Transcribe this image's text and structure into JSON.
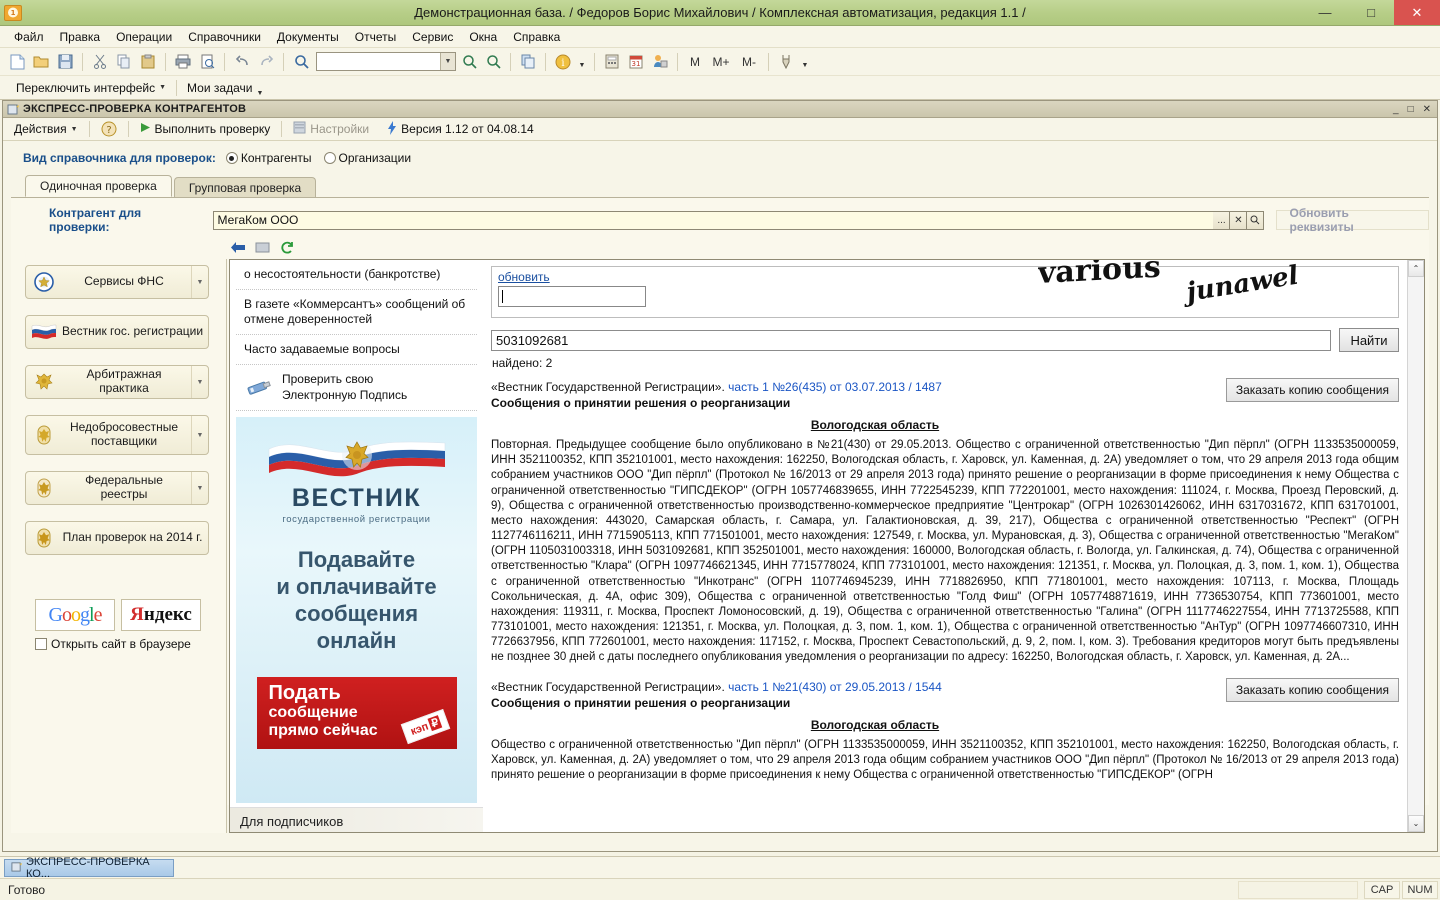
{
  "window": {
    "title": "Демонстрационная база. / Федоров Борис Михайлович /  Комплексная автоматизация, редакция 1.1 /",
    "app_icon": "1C",
    "minimize": "—",
    "maximize": "□",
    "close": "✕"
  },
  "menu": {
    "items": [
      {
        "label": "Файл"
      },
      {
        "label": "Правка"
      },
      {
        "label": "Операции"
      },
      {
        "label": "Справочники"
      },
      {
        "label": "Документы"
      },
      {
        "label": "Отчеты"
      },
      {
        "label": "Сервис"
      },
      {
        "label": "Окна"
      },
      {
        "label": "Справка"
      }
    ]
  },
  "toolbar": {
    "combo_value": "",
    "memory": [
      "M",
      "M+",
      "M-"
    ]
  },
  "toolbar2": {
    "switch_interface": "Переключить интерфейс",
    "my_tasks": "Мои задачи"
  },
  "mdi": {
    "title": "ЭКСПРЕСС-ПРОВЕРКА КОНТРАГЕНТОВ",
    "minimize": "_",
    "maximize": "□",
    "close": "✕",
    "toolbar": {
      "actions": "Действия",
      "help": "?",
      "run_check": "Выполнить проверку",
      "settings": "Настройки",
      "version": "Версия 1.12 от 04.08.14"
    }
  },
  "form": {
    "kind_label": "Вид справочника для проверок:",
    "radio_options": [
      {
        "label": "Контрагенты",
        "selected": true
      },
      {
        "label": "Организации",
        "selected": false
      }
    ],
    "tabs": [
      {
        "label": "Одиночная проверка",
        "active": true
      },
      {
        "label": "Групповая проверка",
        "active": false
      }
    ],
    "contractor_label": "Контрагент для проверки:",
    "contractor_value": "МегаКом ООО",
    "field_buttons": [
      "...",
      "✕",
      "⌕"
    ],
    "refresh_button": "Обновить реквизиты"
  },
  "sidebar": {
    "buttons": [
      {
        "label": "Сервисы ФНС",
        "has_dropdown": true
      },
      {
        "label": "Вестник гос. регистрации",
        "has_dropdown": false
      },
      {
        "label": "Арбитражная практика",
        "has_dropdown": true
      },
      {
        "label": "Недобросовестные поставщики",
        "has_dropdown": true
      },
      {
        "label": "Федеральные реестры",
        "has_dropdown": true
      },
      {
        "label": "План проверок на 2014 г.",
        "has_dropdown": false
      }
    ],
    "search_engines": [
      {
        "name": "Google"
      },
      {
        "name": "Яндекс"
      }
    ],
    "open_in_browser": "Открыть сайт в браузере",
    "open_in_browser_checked": false
  },
  "browser": {
    "menu_items": [
      "о несостоятельности (банкротстве)",
      "В газете «Коммерсантъ» сообщений об отмене доверенностей",
      "Часто задаваемые вопросы"
    ],
    "eds_item": "Проверить свою\nЭлектронную Подпись",
    "eds_line1": "Проверить свою",
    "eds_line2": "Электронную Подпись",
    "banner": {
      "title": "ВЕСТНИК",
      "subtitle": "государственной регистрации",
      "headline_l1": "Подавайте",
      "headline_l2": "и оплачивайте",
      "headline_l3": "сообщения",
      "headline_l4": "онлайн",
      "cta_l1": "Подать",
      "cta_l2": "сообщение",
      "cta_l3": "прямо сейчас",
      "badge": "кэп"
    },
    "subscribers": "Для подписчиков",
    "captcha": {
      "refresh_link": "обновить",
      "input_value": "",
      "image_text_1": "various",
      "image_text_2": "junawel"
    },
    "search": {
      "value": "5031092681",
      "button": "Найти",
      "found": "найдено: 2"
    },
    "results": [
      {
        "source": "«Вестник Государственной Регистрации».",
        "link": "часть 1 №26(435) от 03.07.2013 / 1487",
        "subtitle": "Сообщения о принятии решения о реорганизации",
        "region": "Вологодская область",
        "order_button": "Заказать копию сообщения",
        "body": "Повторная. Предыдущее сообщение было опубликовано в №21(430) от 29.05.2013. Общество с ограниченной ответственностью \"Дип пёрпл\" (ОГРН 1133535000059, ИНН 3521100352, КПП 352101001, место нахождения: 162250, Вологодская область, г. Харовск, ул. Каменная, д. 2А) уведомляет о том, что 29 апреля 2013 года общим собранием участников ООО \"Дип пёрпл\" (Протокол № 16/2013 от 29 апреля 2013 года) принято решение о реорганизации в форме присоединения к нему Общества с ограниченной ответственностью \"ГИПСДЕКОР\" (ОГРН 1057746839655, ИНН 7722545239, КПП 772201001, место нахождения: 111024, г. Москва, Проезд Перовский, д. 9), Общества с ограниченной ответственностью производственно-коммерческое предприятие \"Центрокар\" (ОГРН 1026301426062, ИНН 6317031672, КПП 631701001, место нахождения: 443020, Самарская область, г. Самара, ул. Галактионовская, д. 39, 217), Общества с ограниченной ответственностью \"Респект\" (ОГРН 1127746116211, ИНН 7715905113, КПП 771501001, место нахождения: 127549, г. Москва, ул. Мурановская, д. 3), Общества с ограниченной ответственностью \"МегаКом\" (ОГРН 1105031003318, ИНН 5031092681, КПП 352501001, место нахождения: 160000, Вологодская область, г. Вологда, ул. Галкинская, д. 74), Общества с ограниченной ответственностью \"Клара\" (ОГРН 1097746621345, ИНН 7715778024, КПП 773101001, место нахождения: 121351, г. Москва, ул. Полоцкая, д. 3, пом. 1, ком. 1), Общества с ограниченной ответственностью \"Инкотранс\" (ОГРН 1107746945239, ИНН 7718826950, КПП 771801001, место нахождения: 107113, г. Москва, Площадь Сокольническая, д. 4А, офис 309), Общества с ограниченной ответственностью \"Голд Фиш\" (ОГРН 1057748871619, ИНН 7736530754, КПП 773601001, место нахождения: 119311, г. Москва, Проспект Ломоносовский, д. 19), Общества с ограниченной ответственностью \"Галина\" (ОГРН 1117746227554, ИНН 7713725588, КПП 773101001, место нахождения: 121351, г. Москва, ул. Полоцкая, д. 3, пом. 1, ком. 1), Общества с ограниченной ответственностью \"АнТур\" (ОГРН 1097746607310, ИНН 7726637956, КПП 772601001, место нахождения: 117152, г. Москва, Проспект Севастопольский, д. 9, 2, пом. I, ком. 3). Требования кредиторов могут быть предъявлены не позднее 30 дней с даты последнего опубликования уведомления о реорганизации по адресу: 162250, Вологодская область, г. Харовск, ул. Каменная, д. 2А..."
      },
      {
        "source": "«Вестник Государственной Регистрации».",
        "link": "часть 1 №21(430) от 29.05.2013 / 1544",
        "subtitle": "Сообщения о принятии решения о реорганизации",
        "region": "Вологодская область",
        "order_button": "Заказать копию сообщения",
        "body": "Общество с ограниченной ответственностью \"Дип пёрпл\" (ОГРН 1133535000059, ИНН 3521100352, КПП 352101001, место нахождения: 162250, Вологодская область, г. Харовск, ул. Каменная, д. 2А) уведомляет о том, что 29 апреля 2013 года общим собранием участников ООО \"Дип пёрпл\" (Протокол № 16/2013 от 29 апреля 2013 года) принято решение о реорганизации в форме присоединения к нему Общества с ограниченной ответственностью \"ГИПСДЕКОР\" (ОГРН"
      }
    ]
  },
  "taskbar": {
    "button_label": "ЭКСПРЕСС-ПРОВЕРКА КО..."
  },
  "statusbar": {
    "text": "Готово",
    "cap": "CAP",
    "num": "NUM"
  },
  "colors": {
    "titlebar": "#b7ce88",
    "accent_blue": "#1a4f8a",
    "link_blue": "#1a55c4",
    "banner_red": "#d02020",
    "close_red": "#d9534f"
  }
}
